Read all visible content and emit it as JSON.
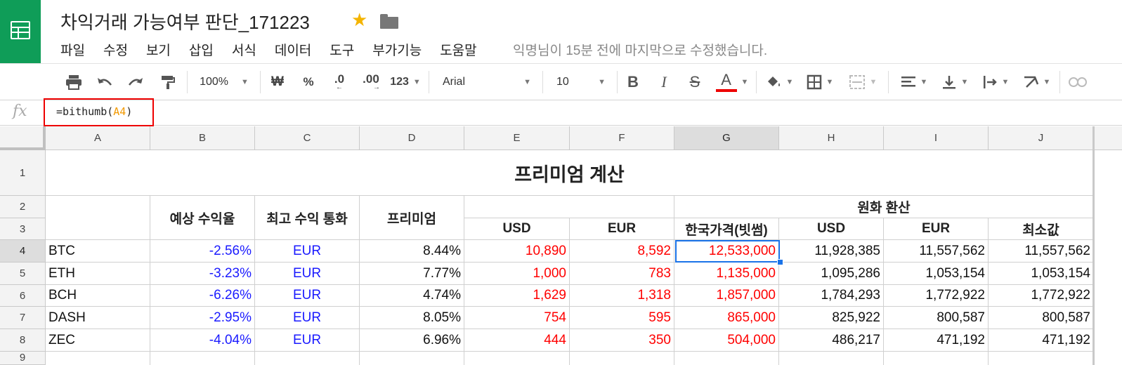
{
  "app": {
    "doc_title": "차익거래 가능여부 판단_171223",
    "menu": [
      "파일",
      "수정",
      "보기",
      "삽입",
      "서식",
      "데이터",
      "도구",
      "부가기능",
      "도움말"
    ],
    "last_edit": "익명님이 15분 전에 마지막으로 수정했습니다."
  },
  "toolbar": {
    "zoom": "100%",
    "currency_symbol": "₩",
    "percent_symbol": "%",
    "decimal_decrease": ".0",
    "decimal_increase": ".00",
    "more_formats": "123",
    "font": "Arial",
    "font_size": "10",
    "bold": "B",
    "italic": "I",
    "strikethrough": "S",
    "text_color_letter": "A",
    "text_color": "#e00000"
  },
  "formula_bar": {
    "fx": "fx",
    "prefix": "=bithumb(",
    "ref": "A4",
    "suffix": ")"
  },
  "grid": {
    "columns": [
      "A",
      "B",
      "C",
      "D",
      "E",
      "F",
      "G",
      "H",
      "I",
      "J"
    ],
    "rows": [
      "1",
      "2",
      "3",
      "4",
      "5",
      "6",
      "7",
      "8",
      "9"
    ],
    "selected_cell": "G4",
    "title": "프리미엄 계산",
    "headers": {
      "expected_return": "예상 수익율",
      "best_currency": "최고 수익 통화",
      "premium": "프리미엄",
      "krw_conversion": "원화 환산",
      "usd_e": "USD",
      "eur_f": "EUR",
      "kr_price": "한국가격(빗썸)",
      "usd_h": "USD",
      "eur_i": "EUR",
      "min": "최소값"
    },
    "data": [
      {
        "coin": "BTC",
        "ret": "-2.56%",
        "cur": "EUR",
        "prem": "8.44%",
        "usd": "10,890",
        "eur": "8,592",
        "kr": "12,533,000",
        "usd_krw": "11,928,385",
        "eur_krw": "11,557,562",
        "min": "11,557,562"
      },
      {
        "coin": "ETH",
        "ret": "-3.23%",
        "cur": "EUR",
        "prem": "7.77%",
        "usd": "1,000",
        "eur": "783",
        "kr": "1,135,000",
        "usd_krw": "1,095,286",
        "eur_krw": "1,053,154",
        "min": "1,053,154"
      },
      {
        "coin": "BCH",
        "ret": "-6.26%",
        "cur": "EUR",
        "prem": "4.74%",
        "usd": "1,629",
        "eur": "1,318",
        "kr": "1,857,000",
        "usd_krw": "1,784,293",
        "eur_krw": "1,772,922",
        "min": "1,772,922"
      },
      {
        "coin": "DASH",
        "ret": "-2.95%",
        "cur": "EUR",
        "prem": "8.05%",
        "usd": "754",
        "eur": "595",
        "kr": "865,000",
        "usd_krw": "825,922",
        "eur_krw": "800,587",
        "min": "800,587"
      },
      {
        "coin": "ZEC",
        "ret": "-4.04%",
        "cur": "EUR",
        "prem": "6.96%",
        "usd": "444",
        "eur": "350",
        "kr": "504,000",
        "usd_krw": "486,217",
        "eur_krw": "471,192",
        "min": "471,192"
      }
    ]
  }
}
